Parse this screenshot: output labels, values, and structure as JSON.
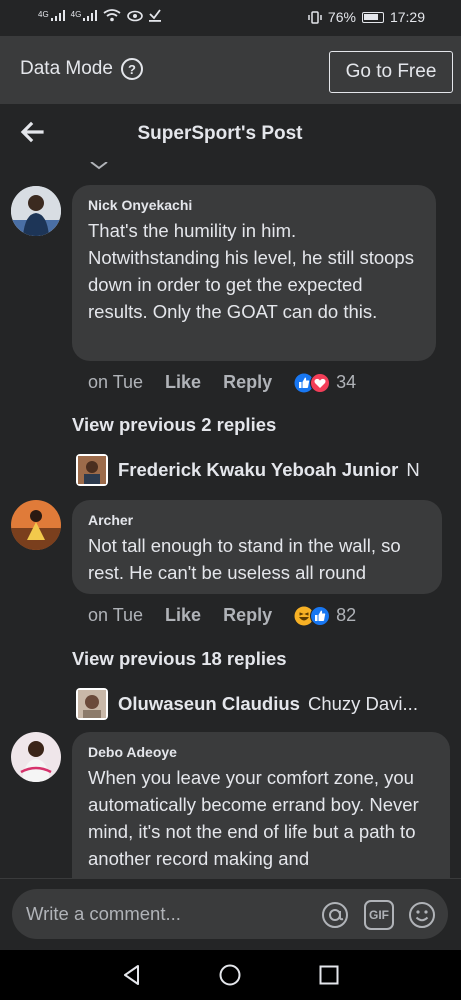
{
  "status_bar": {
    "signal_1": "4G",
    "signal_2": "4G",
    "battery_percent": "76%",
    "time": "17:29",
    "icons": [
      "signal-icon",
      "wifi-icon",
      "eye-icon",
      "download-icon",
      "vibrate-icon",
      "battery-icon"
    ]
  },
  "banner": {
    "label": "Data Mode",
    "help_symbol": "?",
    "go_free_label": "Go to Free"
  },
  "header": {
    "title": "SuperSport's Post"
  },
  "comments": [
    {
      "author": "Nick Onyekachi",
      "text": "That's the humility in him. Notwithstanding his level, he still stoops down in order to get the expected results. Only the GOAT can do this.",
      "time": "on Tue",
      "like_label": "Like",
      "reply_label": "Reply",
      "reactions": [
        "like",
        "love"
      ],
      "reaction_count": "34",
      "view_previous": "View previous 2 replies",
      "reply_preview": {
        "name": "Frederick Kwaku Yeboah Junior",
        "snippet": "N"
      }
    },
    {
      "author": "Archer",
      "text": "Not tall enough to stand in the wall, so rest. He can't be useless all round",
      "time": "on Tue",
      "like_label": "Like",
      "reply_label": "Reply",
      "reactions": [
        "haha",
        "like"
      ],
      "reaction_count": "82",
      "view_previous": "View previous 18 replies",
      "reply_preview": {
        "name": "Oluwaseun Claudius",
        "snippet": "Chuzy Davi..."
      }
    },
    {
      "author": "Debo Adeoye",
      "text": "When you leave your comfort zone, you automatically become errand boy. Never mind, it's not the end of life but a path to another record making and"
    }
  ],
  "composer": {
    "placeholder": "Write a comment...",
    "mention_icon": "at-icon",
    "gif_label": "GIF",
    "sticker_icon": "smiley-icon"
  },
  "colors": {
    "background": "#242526",
    "bubble": "#3a3b3c",
    "text": "#e4e6eb",
    "muted": "#b0b3b8",
    "like_blue": "#1877f2",
    "love_red": "#f33e58",
    "haha_yellow": "#f7b125"
  }
}
